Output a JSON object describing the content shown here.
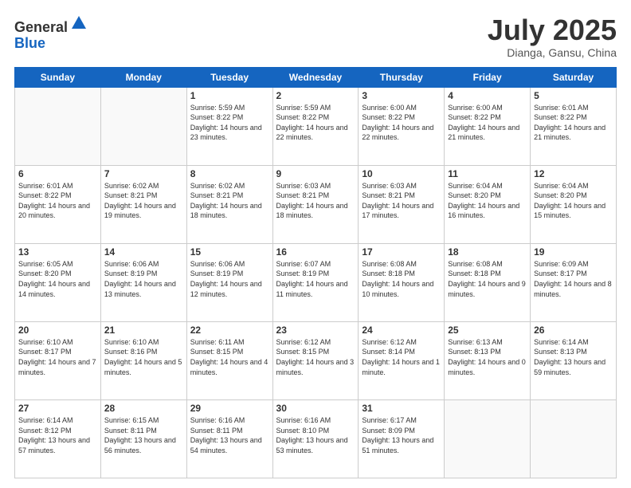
{
  "header": {
    "logo_general": "General",
    "logo_blue": "Blue",
    "month": "July 2025",
    "location": "Dianga, Gansu, China"
  },
  "weekdays": [
    "Sunday",
    "Monday",
    "Tuesday",
    "Wednesday",
    "Thursday",
    "Friday",
    "Saturday"
  ],
  "weeks": [
    [
      {
        "day": "",
        "info": ""
      },
      {
        "day": "",
        "info": ""
      },
      {
        "day": "1",
        "info": "Sunrise: 5:59 AM\nSunset: 8:22 PM\nDaylight: 14 hours and 23 minutes."
      },
      {
        "day": "2",
        "info": "Sunrise: 5:59 AM\nSunset: 8:22 PM\nDaylight: 14 hours and 22 minutes."
      },
      {
        "day": "3",
        "info": "Sunrise: 6:00 AM\nSunset: 8:22 PM\nDaylight: 14 hours and 22 minutes."
      },
      {
        "day": "4",
        "info": "Sunrise: 6:00 AM\nSunset: 8:22 PM\nDaylight: 14 hours and 21 minutes."
      },
      {
        "day": "5",
        "info": "Sunrise: 6:01 AM\nSunset: 8:22 PM\nDaylight: 14 hours and 21 minutes."
      }
    ],
    [
      {
        "day": "6",
        "info": "Sunrise: 6:01 AM\nSunset: 8:22 PM\nDaylight: 14 hours and 20 minutes."
      },
      {
        "day": "7",
        "info": "Sunrise: 6:02 AM\nSunset: 8:21 PM\nDaylight: 14 hours and 19 minutes."
      },
      {
        "day": "8",
        "info": "Sunrise: 6:02 AM\nSunset: 8:21 PM\nDaylight: 14 hours and 18 minutes."
      },
      {
        "day": "9",
        "info": "Sunrise: 6:03 AM\nSunset: 8:21 PM\nDaylight: 14 hours and 18 minutes."
      },
      {
        "day": "10",
        "info": "Sunrise: 6:03 AM\nSunset: 8:21 PM\nDaylight: 14 hours and 17 minutes."
      },
      {
        "day": "11",
        "info": "Sunrise: 6:04 AM\nSunset: 8:20 PM\nDaylight: 14 hours and 16 minutes."
      },
      {
        "day": "12",
        "info": "Sunrise: 6:04 AM\nSunset: 8:20 PM\nDaylight: 14 hours and 15 minutes."
      }
    ],
    [
      {
        "day": "13",
        "info": "Sunrise: 6:05 AM\nSunset: 8:20 PM\nDaylight: 14 hours and 14 minutes."
      },
      {
        "day": "14",
        "info": "Sunrise: 6:06 AM\nSunset: 8:19 PM\nDaylight: 14 hours and 13 minutes."
      },
      {
        "day": "15",
        "info": "Sunrise: 6:06 AM\nSunset: 8:19 PM\nDaylight: 14 hours and 12 minutes."
      },
      {
        "day": "16",
        "info": "Sunrise: 6:07 AM\nSunset: 8:19 PM\nDaylight: 14 hours and 11 minutes."
      },
      {
        "day": "17",
        "info": "Sunrise: 6:08 AM\nSunset: 8:18 PM\nDaylight: 14 hours and 10 minutes."
      },
      {
        "day": "18",
        "info": "Sunrise: 6:08 AM\nSunset: 8:18 PM\nDaylight: 14 hours and 9 minutes."
      },
      {
        "day": "19",
        "info": "Sunrise: 6:09 AM\nSunset: 8:17 PM\nDaylight: 14 hours and 8 minutes."
      }
    ],
    [
      {
        "day": "20",
        "info": "Sunrise: 6:10 AM\nSunset: 8:17 PM\nDaylight: 14 hours and 7 minutes."
      },
      {
        "day": "21",
        "info": "Sunrise: 6:10 AM\nSunset: 8:16 PM\nDaylight: 14 hours and 5 minutes."
      },
      {
        "day": "22",
        "info": "Sunrise: 6:11 AM\nSunset: 8:15 PM\nDaylight: 14 hours and 4 minutes."
      },
      {
        "day": "23",
        "info": "Sunrise: 6:12 AM\nSunset: 8:15 PM\nDaylight: 14 hours and 3 minutes."
      },
      {
        "day": "24",
        "info": "Sunrise: 6:12 AM\nSunset: 8:14 PM\nDaylight: 14 hours and 1 minute."
      },
      {
        "day": "25",
        "info": "Sunrise: 6:13 AM\nSunset: 8:13 PM\nDaylight: 14 hours and 0 minutes."
      },
      {
        "day": "26",
        "info": "Sunrise: 6:14 AM\nSunset: 8:13 PM\nDaylight: 13 hours and 59 minutes."
      }
    ],
    [
      {
        "day": "27",
        "info": "Sunrise: 6:14 AM\nSunset: 8:12 PM\nDaylight: 13 hours and 57 minutes."
      },
      {
        "day": "28",
        "info": "Sunrise: 6:15 AM\nSunset: 8:11 PM\nDaylight: 13 hours and 56 minutes."
      },
      {
        "day": "29",
        "info": "Sunrise: 6:16 AM\nSunset: 8:11 PM\nDaylight: 13 hours and 54 minutes."
      },
      {
        "day": "30",
        "info": "Sunrise: 6:16 AM\nSunset: 8:10 PM\nDaylight: 13 hours and 53 minutes."
      },
      {
        "day": "31",
        "info": "Sunrise: 6:17 AM\nSunset: 8:09 PM\nDaylight: 13 hours and 51 minutes."
      },
      {
        "day": "",
        "info": ""
      },
      {
        "day": "",
        "info": ""
      }
    ]
  ]
}
